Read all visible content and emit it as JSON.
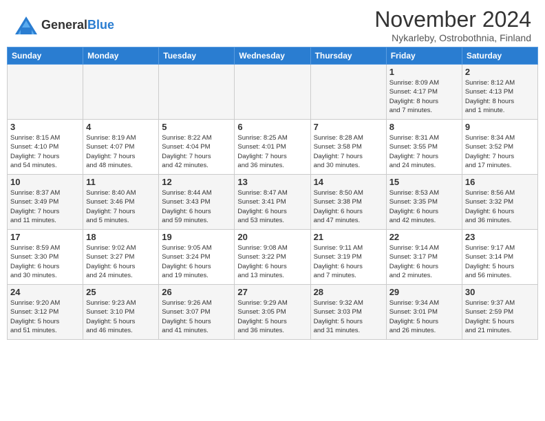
{
  "header": {
    "logo": {
      "general": "General",
      "blue": "Blue"
    },
    "title": "November 2024",
    "location": "Nykarleby, Ostrobothnia, Finland"
  },
  "calendar": {
    "days_of_week": [
      "Sunday",
      "Monday",
      "Tuesday",
      "Wednesday",
      "Thursday",
      "Friday",
      "Saturday"
    ],
    "weeks": [
      [
        {
          "day": "",
          "info": ""
        },
        {
          "day": "",
          "info": ""
        },
        {
          "day": "",
          "info": ""
        },
        {
          "day": "",
          "info": ""
        },
        {
          "day": "",
          "info": ""
        },
        {
          "day": "1",
          "info": "Sunrise: 8:09 AM\nSunset: 4:17 PM\nDaylight: 8 hours\nand 7 minutes."
        },
        {
          "day": "2",
          "info": "Sunrise: 8:12 AM\nSunset: 4:13 PM\nDaylight: 8 hours\nand 1 minute."
        }
      ],
      [
        {
          "day": "3",
          "info": "Sunrise: 8:15 AM\nSunset: 4:10 PM\nDaylight: 7 hours\nand 54 minutes."
        },
        {
          "day": "4",
          "info": "Sunrise: 8:19 AM\nSunset: 4:07 PM\nDaylight: 7 hours\nand 48 minutes."
        },
        {
          "day": "5",
          "info": "Sunrise: 8:22 AM\nSunset: 4:04 PM\nDaylight: 7 hours\nand 42 minutes."
        },
        {
          "day": "6",
          "info": "Sunrise: 8:25 AM\nSunset: 4:01 PM\nDaylight: 7 hours\nand 36 minutes."
        },
        {
          "day": "7",
          "info": "Sunrise: 8:28 AM\nSunset: 3:58 PM\nDaylight: 7 hours\nand 30 minutes."
        },
        {
          "day": "8",
          "info": "Sunrise: 8:31 AM\nSunset: 3:55 PM\nDaylight: 7 hours\nand 24 minutes."
        },
        {
          "day": "9",
          "info": "Sunrise: 8:34 AM\nSunset: 3:52 PM\nDaylight: 7 hours\nand 17 minutes."
        }
      ],
      [
        {
          "day": "10",
          "info": "Sunrise: 8:37 AM\nSunset: 3:49 PM\nDaylight: 7 hours\nand 11 minutes."
        },
        {
          "day": "11",
          "info": "Sunrise: 8:40 AM\nSunset: 3:46 PM\nDaylight: 7 hours\nand 5 minutes."
        },
        {
          "day": "12",
          "info": "Sunrise: 8:44 AM\nSunset: 3:43 PM\nDaylight: 6 hours\nand 59 minutes."
        },
        {
          "day": "13",
          "info": "Sunrise: 8:47 AM\nSunset: 3:41 PM\nDaylight: 6 hours\nand 53 minutes."
        },
        {
          "day": "14",
          "info": "Sunrise: 8:50 AM\nSunset: 3:38 PM\nDaylight: 6 hours\nand 47 minutes."
        },
        {
          "day": "15",
          "info": "Sunrise: 8:53 AM\nSunset: 3:35 PM\nDaylight: 6 hours\nand 42 minutes."
        },
        {
          "day": "16",
          "info": "Sunrise: 8:56 AM\nSunset: 3:32 PM\nDaylight: 6 hours\nand 36 minutes."
        }
      ],
      [
        {
          "day": "17",
          "info": "Sunrise: 8:59 AM\nSunset: 3:30 PM\nDaylight: 6 hours\nand 30 minutes."
        },
        {
          "day": "18",
          "info": "Sunrise: 9:02 AM\nSunset: 3:27 PM\nDaylight: 6 hours\nand 24 minutes."
        },
        {
          "day": "19",
          "info": "Sunrise: 9:05 AM\nSunset: 3:24 PM\nDaylight: 6 hours\nand 19 minutes."
        },
        {
          "day": "20",
          "info": "Sunrise: 9:08 AM\nSunset: 3:22 PM\nDaylight: 6 hours\nand 13 minutes."
        },
        {
          "day": "21",
          "info": "Sunrise: 9:11 AM\nSunset: 3:19 PM\nDaylight: 6 hours\nand 7 minutes."
        },
        {
          "day": "22",
          "info": "Sunrise: 9:14 AM\nSunset: 3:17 PM\nDaylight: 6 hours\nand 2 minutes."
        },
        {
          "day": "23",
          "info": "Sunrise: 9:17 AM\nSunset: 3:14 PM\nDaylight: 5 hours\nand 56 minutes."
        }
      ],
      [
        {
          "day": "24",
          "info": "Sunrise: 9:20 AM\nSunset: 3:12 PM\nDaylight: 5 hours\nand 51 minutes."
        },
        {
          "day": "25",
          "info": "Sunrise: 9:23 AM\nSunset: 3:10 PM\nDaylight: 5 hours\nand 46 minutes."
        },
        {
          "day": "26",
          "info": "Sunrise: 9:26 AM\nSunset: 3:07 PM\nDaylight: 5 hours\nand 41 minutes."
        },
        {
          "day": "27",
          "info": "Sunrise: 9:29 AM\nSunset: 3:05 PM\nDaylight: 5 hours\nand 36 minutes."
        },
        {
          "day": "28",
          "info": "Sunrise: 9:32 AM\nSunset: 3:03 PM\nDaylight: 5 hours\nand 31 minutes."
        },
        {
          "day": "29",
          "info": "Sunrise: 9:34 AM\nSunset: 3:01 PM\nDaylight: 5 hours\nand 26 minutes."
        },
        {
          "day": "30",
          "info": "Sunrise: 9:37 AM\nSunset: 2:59 PM\nDaylight: 5 hours\nand 21 minutes."
        }
      ]
    ]
  }
}
